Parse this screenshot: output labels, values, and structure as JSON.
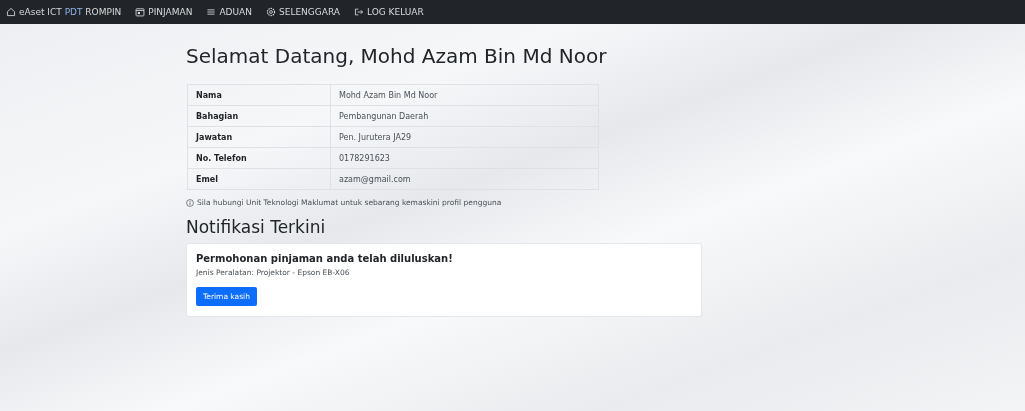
{
  "navbar": {
    "brand": {
      "prefix": "eAset ICT",
      "highlight": "PDT",
      "suffix": "ROMPIN"
    },
    "items": [
      {
        "label": "PINJAMAN"
      },
      {
        "label": "ADUAN"
      },
      {
        "label": "SELENGGARA"
      },
      {
        "label": "LOG KELUAR"
      }
    ]
  },
  "heading": "Selamat Datang, Mohd Azam Bin Md Noor",
  "profile": [
    {
      "label": "Nama",
      "value": "Mohd Azam Bin Md Noor"
    },
    {
      "label": "Bahagian",
      "value": "Pembangunan Daerah"
    },
    {
      "label": "Jawatan",
      "value": "Pen. Jurutera JA29"
    },
    {
      "label": "No. Telefon",
      "value": "0178291623"
    },
    {
      "label": "Emel",
      "value": "azam@gmail.com"
    }
  ],
  "note": "Sila hubungi Unit Teknologi Maklumat untuk sebarang kemaskini profil pengguna",
  "notifications_title": "Notifikasi Terkini",
  "notifications": [
    {
      "title": "Permohonan pinjaman anda telah diluluskan!",
      "detail": "Jenis Peralatan: Projektor - Epson EB-X06",
      "button": "Terima kasih"
    }
  ]
}
